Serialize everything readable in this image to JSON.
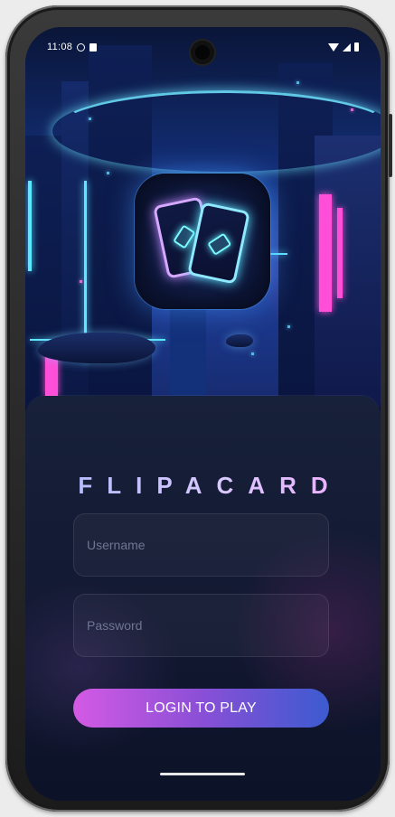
{
  "status_bar": {
    "time": "11:08"
  },
  "app": {
    "title": "FLIPACARD"
  },
  "login_form": {
    "username_placeholder": "Username",
    "password_placeholder": "Password",
    "login_button_label": "LOGIN TO PLAY"
  },
  "colors": {
    "button_gradient_start": "#d45ae4",
    "button_gradient_end": "#3c5bd0",
    "title_gradient_start": "#a9b6ff",
    "title_gradient_end": "#f3a8ff"
  }
}
